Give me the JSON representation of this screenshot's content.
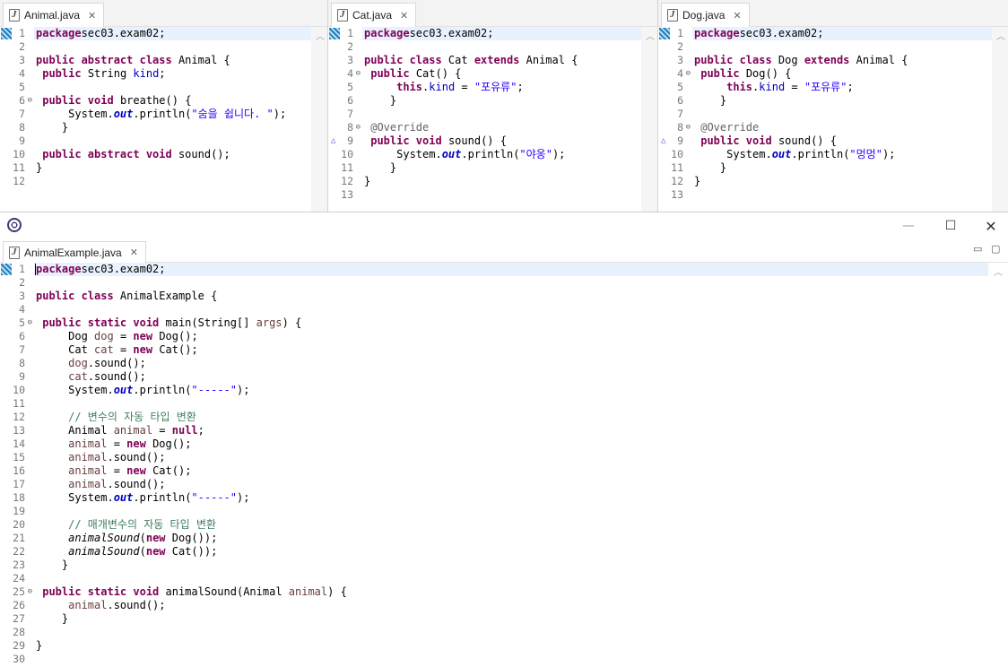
{
  "top_editors": [
    {
      "tab_label": "Animal.java",
      "lines": [
        [
          [
            "kw",
            "package"
          ],
          [
            "",
            "sec03.exam02;"
          ]
        ],
        [],
        [
          [
            "kw",
            "public abstract class"
          ],
          [
            "",
            " Animal {"
          ]
        ],
        [
          [
            "",
            " "
          ],
          [
            "kw",
            "public"
          ],
          [
            "",
            " String "
          ],
          [
            "fld",
            "kind"
          ],
          [
            "",
            ";"
          ]
        ],
        [],
        [
          [
            "",
            " "
          ],
          [
            "kw",
            "public void"
          ],
          [
            "",
            " breathe() {"
          ]
        ],
        [
          [
            "",
            "     System."
          ],
          [
            "sfld",
            "out"
          ],
          [
            "",
            ".println("
          ],
          [
            "str",
            "\"숨을 쉽니다. \""
          ],
          [
            "",
            ");"
          ]
        ],
        [
          [
            "",
            "    }"
          ]
        ],
        [],
        [
          [
            "",
            " "
          ],
          [
            "kw",
            "public abstract void"
          ],
          [
            "",
            " sound();"
          ]
        ],
        [
          [
            "",
            "}"
          ]
        ],
        []
      ],
      "fold_lines": [
        6
      ],
      "override_lines": []
    },
    {
      "tab_label": "Cat.java",
      "lines": [
        [
          [
            "kw",
            "package"
          ],
          [
            "",
            "sec03.exam02;"
          ]
        ],
        [],
        [
          [
            "kw",
            "public class"
          ],
          [
            "",
            " Cat "
          ],
          [
            "kw",
            "extends"
          ],
          [
            "",
            " Animal {"
          ]
        ],
        [
          [
            "",
            " "
          ],
          [
            "kw",
            "public"
          ],
          [
            "",
            " Cat() {"
          ]
        ],
        [
          [
            "",
            "     "
          ],
          [
            "kw",
            "this"
          ],
          [
            "",
            "."
          ],
          [
            "fld",
            "kind"
          ],
          [
            "",
            " = "
          ],
          [
            "str",
            "\"포유류\""
          ],
          [
            "",
            ";"
          ]
        ],
        [
          [
            "",
            "    }"
          ]
        ],
        [],
        [
          [
            "",
            " "
          ],
          [
            "ann",
            "@Override"
          ]
        ],
        [
          [
            "",
            " "
          ],
          [
            "kw",
            "public void"
          ],
          [
            "",
            " sound() {"
          ]
        ],
        [
          [
            "",
            "     System."
          ],
          [
            "sfld",
            "out"
          ],
          [
            "",
            ".println("
          ],
          [
            "str",
            "\"야옹\""
          ],
          [
            "",
            ");"
          ]
        ],
        [
          [
            "",
            "    }"
          ]
        ],
        [
          [
            "",
            "}"
          ]
        ],
        []
      ],
      "fold_lines": [
        4,
        8
      ],
      "override_lines": [
        9
      ]
    },
    {
      "tab_label": "Dog.java",
      "lines": [
        [
          [
            "kw",
            "package"
          ],
          [
            "",
            "sec03.exam02;"
          ]
        ],
        [],
        [
          [
            "kw",
            "public class"
          ],
          [
            "",
            " Dog "
          ],
          [
            "kw",
            "extends"
          ],
          [
            "",
            " Animal {"
          ]
        ],
        [
          [
            "",
            " "
          ],
          [
            "kw",
            "public"
          ],
          [
            "",
            " Dog() {"
          ]
        ],
        [
          [
            "",
            "     "
          ],
          [
            "kw",
            "this"
          ],
          [
            "",
            "."
          ],
          [
            "fld",
            "kind"
          ],
          [
            "",
            " = "
          ],
          [
            "str",
            "\"포유류\""
          ],
          [
            "",
            ";"
          ]
        ],
        [
          [
            "",
            "    }"
          ]
        ],
        [],
        [
          [
            "",
            " "
          ],
          [
            "ann",
            "@Override"
          ]
        ],
        [
          [
            "",
            " "
          ],
          [
            "kw",
            "public void"
          ],
          [
            "",
            " sound() {"
          ]
        ],
        [
          [
            "",
            "     System."
          ],
          [
            "sfld",
            "out"
          ],
          [
            "",
            ".println("
          ],
          [
            "str",
            "\"멍멍\""
          ],
          [
            "",
            ");"
          ]
        ],
        [
          [
            "",
            "    }"
          ]
        ],
        [
          [
            "",
            "}"
          ]
        ],
        []
      ],
      "fold_lines": [
        4,
        8
      ],
      "override_lines": [
        9
      ]
    }
  ],
  "bottom_window": {
    "window_controls": {
      "minimize": "—",
      "maximize": "☐",
      "close": "✕"
    },
    "view_controls": {
      "minimize": "▭",
      "maximize": "▢"
    },
    "tab_close": "✕",
    "editor": {
      "tab_label": "AnimalExample.java",
      "lines": [
        [
          [
            "kw",
            "package"
          ],
          [
            "",
            "sec03.exam02;"
          ]
        ],
        [],
        [
          [
            "kw",
            "public class"
          ],
          [
            "",
            " AnimalExample {"
          ]
        ],
        [],
        [
          [
            "",
            " "
          ],
          [
            "kw",
            "public static void"
          ],
          [
            "",
            " main(String[] "
          ],
          [
            "var",
            "args"
          ],
          [
            "",
            ") {"
          ]
        ],
        [
          [
            "",
            "     Dog "
          ],
          [
            "var",
            "dog"
          ],
          [
            "",
            " = "
          ],
          [
            "kw",
            "new"
          ],
          [
            "",
            " Dog();"
          ]
        ],
        [
          [
            "",
            "     Cat "
          ],
          [
            "var",
            "cat"
          ],
          [
            "",
            " = "
          ],
          [
            "kw",
            "new"
          ],
          [
            "",
            " Cat();"
          ]
        ],
        [
          [
            "",
            "     "
          ],
          [
            "var",
            "dog"
          ],
          [
            "",
            ".sound();"
          ]
        ],
        [
          [
            "",
            "     "
          ],
          [
            "var",
            "cat"
          ],
          [
            "",
            ".sound();"
          ]
        ],
        [
          [
            "",
            "     System."
          ],
          [
            "sfld",
            "out"
          ],
          [
            "",
            ".println("
          ],
          [
            "str",
            "\"-----\""
          ],
          [
            "",
            ");"
          ]
        ],
        [],
        [
          [
            "",
            "     "
          ],
          [
            "cmt",
            "// 변수의 자동 타입 변환"
          ]
        ],
        [
          [
            "",
            "     Animal "
          ],
          [
            "var",
            "animal"
          ],
          [
            "",
            " = "
          ],
          [
            "kw",
            "null"
          ],
          [
            "",
            ";"
          ]
        ],
        [
          [
            "",
            "     "
          ],
          [
            "var",
            "animal"
          ],
          [
            "",
            " = "
          ],
          [
            "kw",
            "new"
          ],
          [
            "",
            " Dog();"
          ]
        ],
        [
          [
            "",
            "     "
          ],
          [
            "var",
            "animal"
          ],
          [
            "",
            ".sound();"
          ]
        ],
        [
          [
            "",
            "     "
          ],
          [
            "var",
            "animal"
          ],
          [
            "",
            " = "
          ],
          [
            "kw",
            "new"
          ],
          [
            "",
            " Cat();"
          ]
        ],
        [
          [
            "",
            "     "
          ],
          [
            "var",
            "animal"
          ],
          [
            "",
            ".sound();"
          ]
        ],
        [
          [
            "",
            "     System."
          ],
          [
            "sfld",
            "out"
          ],
          [
            "",
            ".println("
          ],
          [
            "str",
            "\"-----\""
          ],
          [
            "",
            ");"
          ]
        ],
        [],
        [
          [
            "",
            "     "
          ],
          [
            "cmt",
            "// 매개변수의 자동 타입 변환"
          ]
        ],
        [
          [
            "",
            "     "
          ],
          [
            "smc",
            "animalSound"
          ],
          [
            "",
            "("
          ],
          [
            "kw",
            "new"
          ],
          [
            "",
            " Dog());"
          ]
        ],
        [
          [
            "",
            "     "
          ],
          [
            "smc",
            "animalSound"
          ],
          [
            "",
            "("
          ],
          [
            "kw",
            "new"
          ],
          [
            "",
            " Cat());"
          ]
        ],
        [
          [
            "",
            "    }"
          ]
        ],
        [],
        [
          [
            "",
            " "
          ],
          [
            "kw",
            "public static void"
          ],
          [
            "",
            " animalSound(Animal "
          ],
          [
            "var",
            "animal"
          ],
          [
            "",
            ") {"
          ]
        ],
        [
          [
            "",
            "     "
          ],
          [
            "var",
            "animal"
          ],
          [
            "",
            ".sound();"
          ]
        ],
        [
          [
            "",
            "    }"
          ]
        ],
        [],
        [
          [
            "",
            "}"
          ]
        ],
        []
      ],
      "fold_lines": [
        5,
        25
      ],
      "override_lines": []
    }
  },
  "top_tab_close": "✕"
}
